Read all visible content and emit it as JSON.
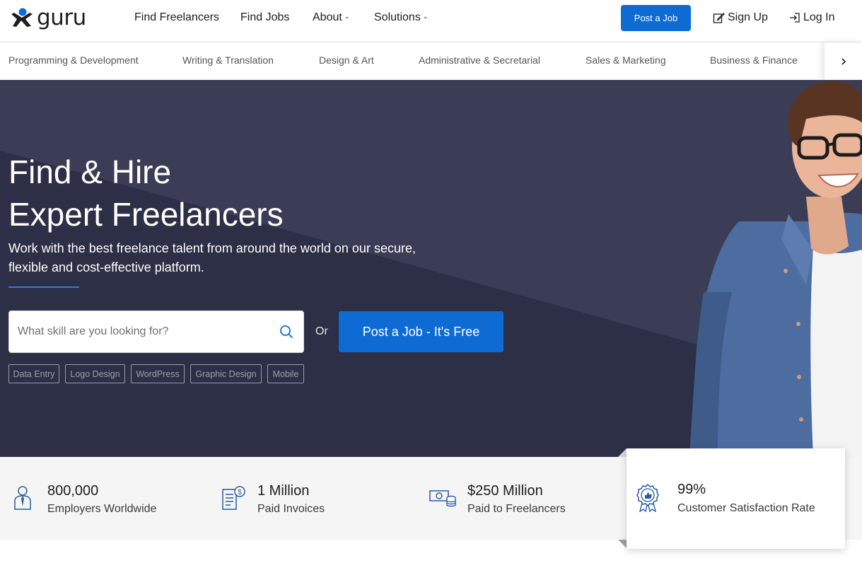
{
  "brand": {
    "logo_text": "guru",
    "primary_color": "#0e6bd4",
    "hero_bg": "#2c2f45"
  },
  "nav": {
    "links": [
      {
        "label": "Find Freelancers",
        "has_dropdown": false
      },
      {
        "label": "Find Jobs",
        "has_dropdown": false
      },
      {
        "label": "About",
        "has_dropdown": true
      },
      {
        "label": "Solutions",
        "has_dropdown": true
      }
    ],
    "post_job_label": "Post a Job",
    "sign_up_label": "Sign Up",
    "log_in_label": "Log In",
    "icons": {
      "sign_up": "edit-icon",
      "log_in": "login-icon",
      "dropdown": "chevron-down-icon"
    }
  },
  "categories": {
    "items": [
      "Programming & Development",
      "Writing & Translation",
      "Design & Art",
      "Administrative & Secretarial",
      "Sales & Marketing",
      "Business & Finance"
    ],
    "next_icon": "chevron-right-icon"
  },
  "hero": {
    "title_line1": "Find & Hire",
    "title_line2": "Expert Freelancers",
    "subtitle_line1": "Work with the best freelance talent from around the world on our secure,",
    "subtitle_line2": "flexible and cost-effective platform.",
    "search": {
      "placeholder": "What skill are you looking for?",
      "value": "",
      "icon": "search-icon"
    },
    "or_label": "Or",
    "cta_label": "Post a Job - It's Free",
    "tags": [
      "Data Entry",
      "Logo Design",
      "WordPress",
      "Graphic Design",
      "Mobile"
    ]
  },
  "stats": [
    {
      "value": "800,000",
      "label": "Employers Worldwide",
      "icon": "employer-icon"
    },
    {
      "value": "1 Million",
      "label": "Paid Invoices",
      "icon": "invoice-icon"
    },
    {
      "value": "$250 Million",
      "label": "Paid to Freelancers",
      "icon": "money-icon"
    },
    {
      "value": "99%",
      "label": "Customer Satisfaction Rate",
      "icon": "award-badge-icon"
    }
  ]
}
